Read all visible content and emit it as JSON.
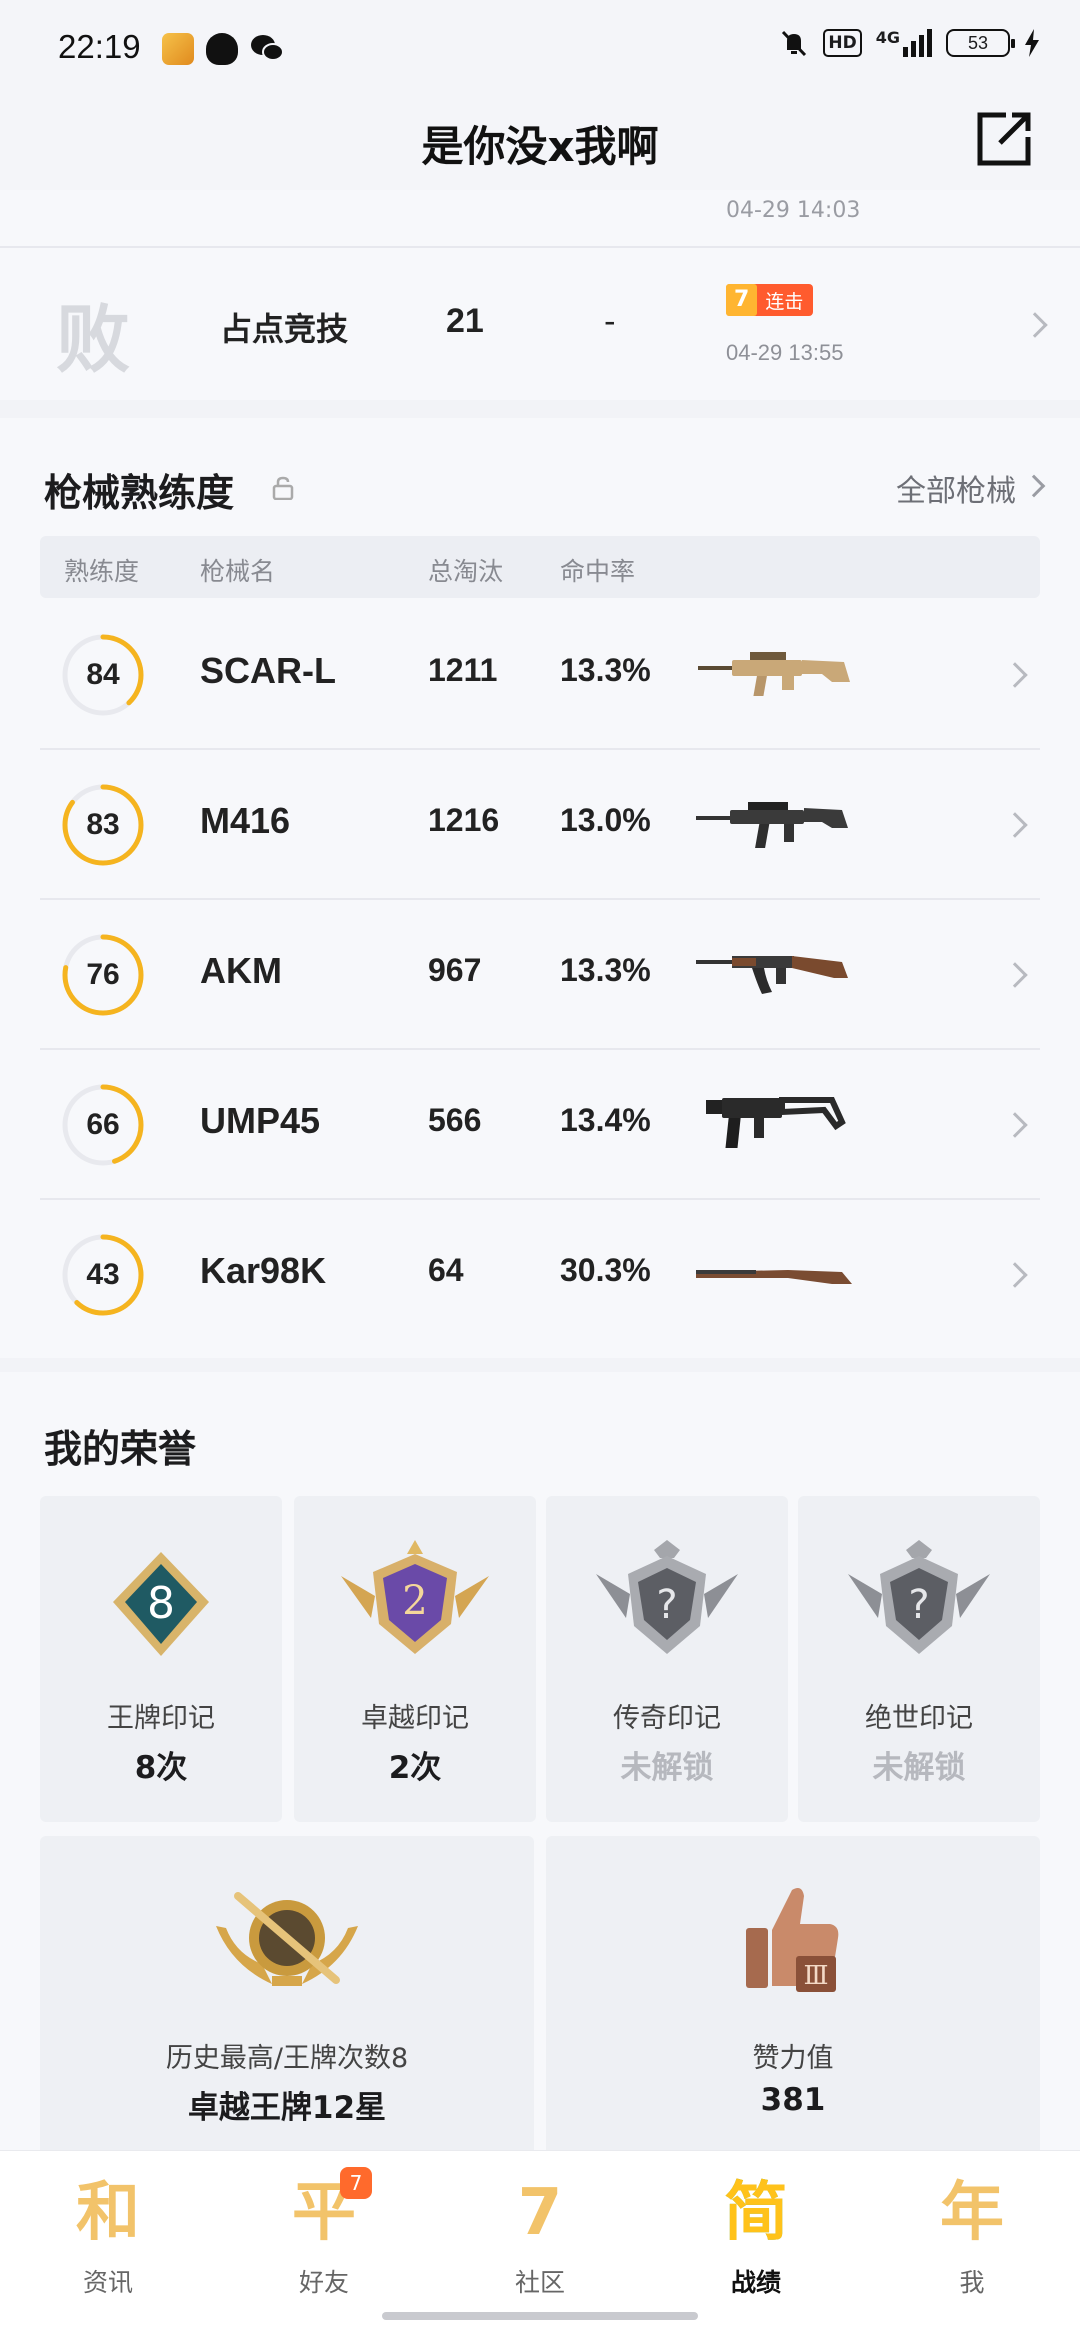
{
  "status_bar": {
    "time": "22:19",
    "network": "4G",
    "hd": "HD",
    "battery": "53"
  },
  "header": {
    "title": "是你没x我啊",
    "share_icon": "share-icon"
  },
  "match_list": {
    "partial_row": {
      "time": "04-29 14:03"
    },
    "row": {
      "result": "败",
      "mode": "占点竞技",
      "kills": "21",
      "rank": "-",
      "streak_count": "7",
      "streak_label": "连击",
      "time": "04-29 13:55"
    }
  },
  "weapons": {
    "title": "枪械熟练度",
    "all_link": "全部枪械",
    "columns": [
      "熟练度",
      "枪械名",
      "总淘汰",
      "命中率"
    ],
    "rows": [
      {
        "proficiency": "84",
        "progress": 0.38,
        "name": "SCAR-L",
        "kills": "1211",
        "hit_rate": "13.3%",
        "icon": "scar-l-rifle-icon"
      },
      {
        "proficiency": "83",
        "progress": 0.85,
        "name": "M416",
        "kills": "1216",
        "hit_rate": "13.0%",
        "icon": "m416-rifle-icon"
      },
      {
        "proficiency": "76",
        "progress": 0.78,
        "name": "AKM",
        "kills": "967",
        "hit_rate": "13.3%",
        "icon": "akm-rifle-icon"
      },
      {
        "proficiency": "66",
        "progress": 0.45,
        "name": "UMP45",
        "kills": "566",
        "hit_rate": "13.4%",
        "icon": "ump45-smg-icon"
      },
      {
        "proficiency": "43",
        "progress": 0.62,
        "name": "Kar98K",
        "kills": "64",
        "hit_rate": "30.3%",
        "icon": "kar98k-sniper-icon"
      }
    ]
  },
  "honors": {
    "title": "我的荣誉",
    "marks": [
      {
        "label": "王牌印记",
        "value": "8次",
        "badge_text": "8",
        "locked": false
      },
      {
        "label": "卓越印记",
        "value": "2次",
        "badge_text": "2",
        "locked": false
      },
      {
        "label": "传奇印记",
        "value": "未解锁",
        "badge_text": "?",
        "locked": true
      },
      {
        "label": "绝世印记",
        "value": "未解锁",
        "badge_text": "?",
        "locked": true
      }
    ],
    "best": {
      "label": "历史最高/王牌次数8",
      "value": "卓越王牌12星"
    },
    "effort": {
      "label": "赞力值",
      "value": "381"
    }
  },
  "bottom_nav": [
    {
      "glyph": "和",
      "label": "资讯",
      "active": false,
      "badge": ""
    },
    {
      "glyph": "平",
      "label": "好友",
      "active": false,
      "badge": "7"
    },
    {
      "glyph": "7",
      "label": "社区",
      "active": false,
      "badge": ""
    },
    {
      "glyph": "简",
      "label": "战绩",
      "active": true,
      "badge": ""
    },
    {
      "glyph": "年",
      "label": "我",
      "active": false,
      "badge": ""
    }
  ],
  "colors": {
    "accent": "#f5b41f",
    "ring_track": "#e8e9ee",
    "streak": "#ff5b2e"
  }
}
